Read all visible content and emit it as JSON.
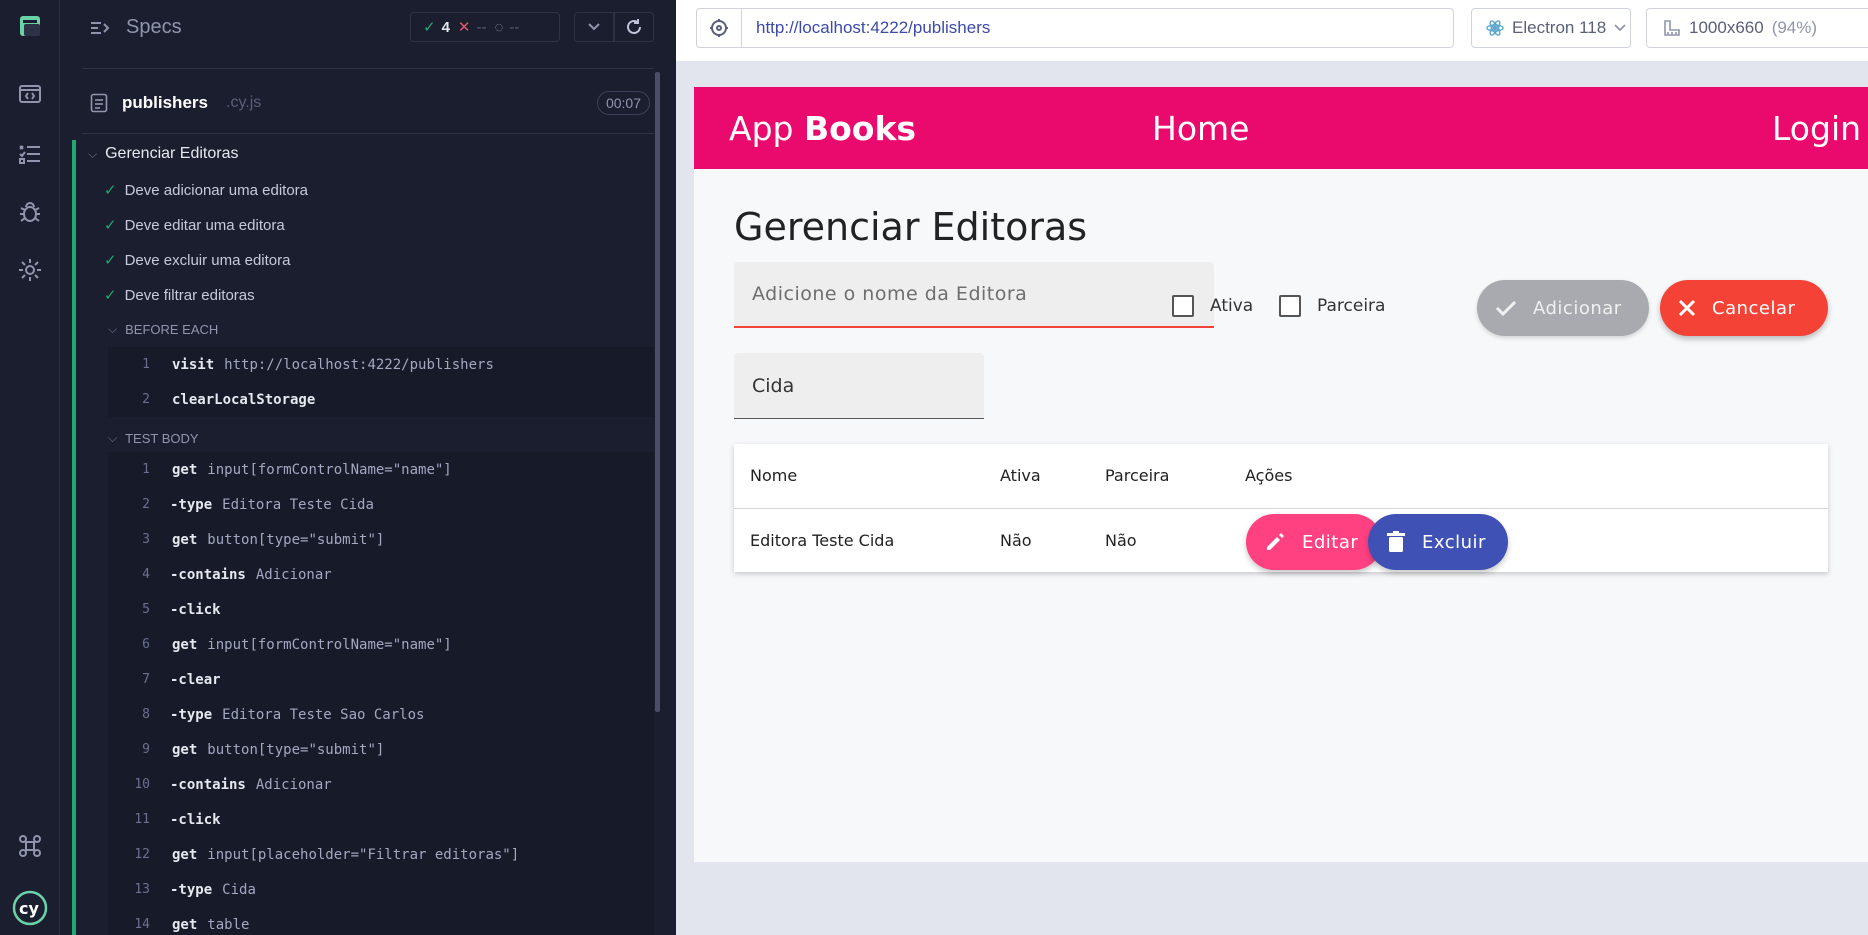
{
  "colors": {
    "runner_bg": "#1b1e2e",
    "pass": "#1fa971",
    "fail": "#e45770",
    "app_primary": "#ea0a6e",
    "button_accent": "#ff4081",
    "button_warn": "#f44336",
    "button_primary": "#3f51b5"
  },
  "rail": {
    "icons": [
      "cypress-logo-icon",
      "specs-icon",
      "runs-icon",
      "debug-icon",
      "settings-icon",
      "keyboard-shortcuts-icon",
      "cy-logo-icon"
    ]
  },
  "runner": {
    "specs_label": "Specs",
    "stats": {
      "passed": "4",
      "failed": "--",
      "pending": "--"
    },
    "file": {
      "name": "publishers",
      "ext": ".cy.js",
      "duration": "00:07"
    },
    "suite_title": "Gerenciar Editoras",
    "tests": [
      "Deve adicionar uma editora",
      "Deve editar uma editora",
      "Deve excluir uma editora",
      "Deve filtrar editoras"
    ],
    "before_each": {
      "title": "BEFORE EACH",
      "commands": [
        {
          "num": "1",
          "name": "visit",
          "arg": "http://localhost:4222/publishers"
        },
        {
          "num": "2",
          "name": "clearLocalStorage",
          "arg": ""
        }
      ]
    },
    "test_body": {
      "title": "TEST BODY",
      "commands": [
        {
          "num": "1",
          "name": "get",
          "arg": "input[formControlName=\"name\"]"
        },
        {
          "num": "2",
          "name": "-type",
          "arg": "Editora Teste Cida"
        },
        {
          "num": "3",
          "name": "get",
          "arg": "button[type=\"submit\"]"
        },
        {
          "num": "4",
          "name": "-contains",
          "arg": "Adicionar"
        },
        {
          "num": "5",
          "name": "-click",
          "arg": ""
        },
        {
          "num": "6",
          "name": "get",
          "arg": "input[formControlName=\"name\"]"
        },
        {
          "num": "7",
          "name": "-clear",
          "arg": ""
        },
        {
          "num": "8",
          "name": "-type",
          "arg": "Editora Teste Sao Carlos"
        },
        {
          "num": "9",
          "name": "get",
          "arg": "button[type=\"submit\"]"
        },
        {
          "num": "10",
          "name": "-contains",
          "arg": "Adicionar"
        },
        {
          "num": "11",
          "name": "-click",
          "arg": ""
        },
        {
          "num": "12",
          "name": "get",
          "arg": "input[placeholder=\"Filtrar editoras\"]"
        },
        {
          "num": "13",
          "name": "-type",
          "arg": "Cida"
        },
        {
          "num": "14",
          "name": "get",
          "arg": "table"
        }
      ]
    }
  },
  "browser": {
    "url": "http://localhost:4222/publishers",
    "engine": "Electron 118",
    "viewport": "1000x660",
    "zoom": "(94%)"
  },
  "app": {
    "brand_light": "App ",
    "brand_bold": "Books",
    "nav_home": "Home",
    "nav_login": "Login",
    "page_title": "Gerenciar Editoras",
    "name_placeholder": "Adicione o nome da Editora",
    "checkbox_active": "Ativa",
    "checkbox_partner": "Parceira",
    "add_button": "Adicionar",
    "cancel_button": "Cancelar",
    "filter_value": "Cida",
    "table": {
      "headers": [
        "Nome",
        "Ativa",
        "Parceira",
        "Ações"
      ],
      "rows": [
        {
          "name": "Editora Teste Cida",
          "active": "Não",
          "partner": "Não"
        }
      ],
      "edit_button": "Editar",
      "delete_button": "Excluir"
    }
  }
}
